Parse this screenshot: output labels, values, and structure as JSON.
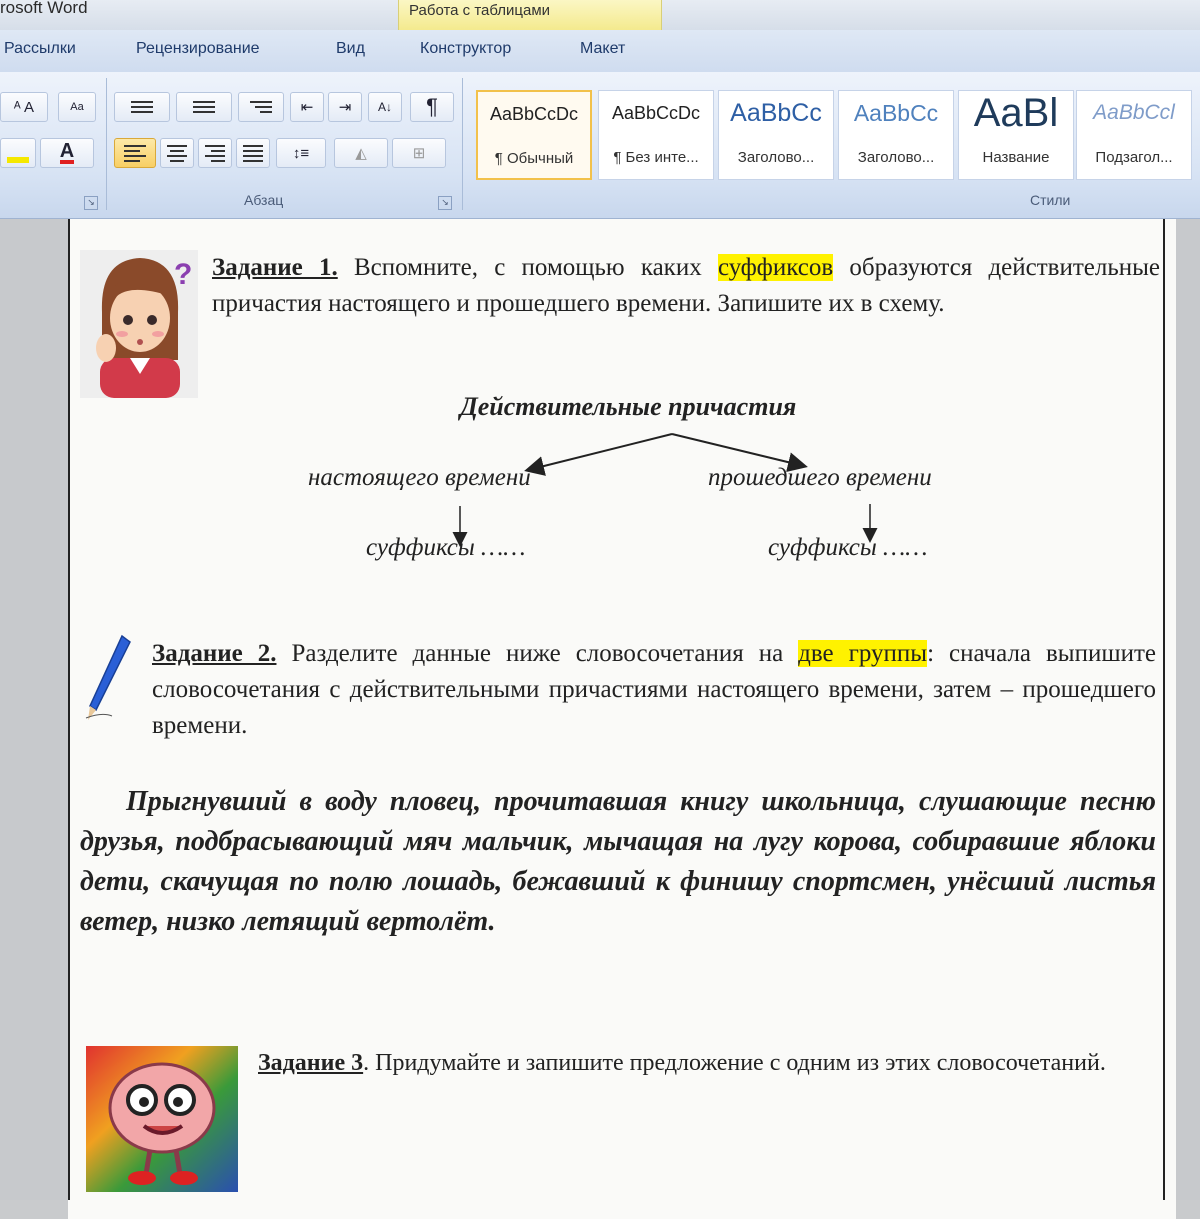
{
  "window": {
    "app_title": "rosoft Word",
    "context_tab_header": "Работа с таблицами"
  },
  "tabs": [
    "Рассылки",
    "Рецензирование",
    "Вид",
    "Конструктор",
    "Макет"
  ],
  "ribbon": {
    "paragraph_group_label": "Абзац",
    "styles_group_label": "Стили",
    "styles": [
      {
        "sample": "AaBbCcDc",
        "name": "¶ Обычный",
        "selected": true
      },
      {
        "sample": "AaBbCcDc",
        "name": "¶ Без инте...",
        "selected": false
      },
      {
        "sample": "AaBbCc",
        "name": "Заголово...",
        "selected": false
      },
      {
        "sample": "AaBbCc",
        "name": "Заголово...",
        "selected": false
      },
      {
        "sample": "AaBl",
        "name": "Название",
        "selected": false
      },
      {
        "sample": "AaBbCcl",
        "name": "Подзагол...",
        "selected": false
      }
    ],
    "font_color_letter": "A",
    "pilcrow": "¶"
  },
  "colors": {
    "highlight": "#fff200",
    "ribbon_blue": "#d7e3f4",
    "selected_style": "#f2c14b"
  },
  "document": {
    "task1": {
      "label": "Задание 1.",
      "text_before": "Вспомните, с помощью каких",
      "highlight": "суффиксов",
      "text_after": "образуются действительные причастия настоящего и прошедшего времени. Запишите их в схему."
    },
    "diagram": {
      "title": "Действительные причастия",
      "left_branch": "настоящего времени",
      "right_branch": "прошедшего времени",
      "left_leaf": "суффиксы ……",
      "right_leaf": "суффиксы ……"
    },
    "task2": {
      "label": "Задание 2.",
      "text_before": "Разделите данные ниже словосочетания на",
      "highlight": "две группы",
      "text_after": ": сначала выпишите словосочетания с действительными причастиями настоящего времени, затем –  прошедшего времени."
    },
    "phrases": "Прыгнувший в воду пловец, прочитавшая книгу школьница, слушающие песню друзья, подбрасывающий мяч мальчик, мычащая на лугу корова, собиравшие яблоки дети, скачущая по полю лошадь, бежавший к финишу спортсмен, унёсший листья ветер, низко летящий вертолёт.",
    "task3": {
      "label": "Задание 3",
      "text": ". Придумайте и запишите предложение с одним из этих словосочетаний."
    }
  }
}
